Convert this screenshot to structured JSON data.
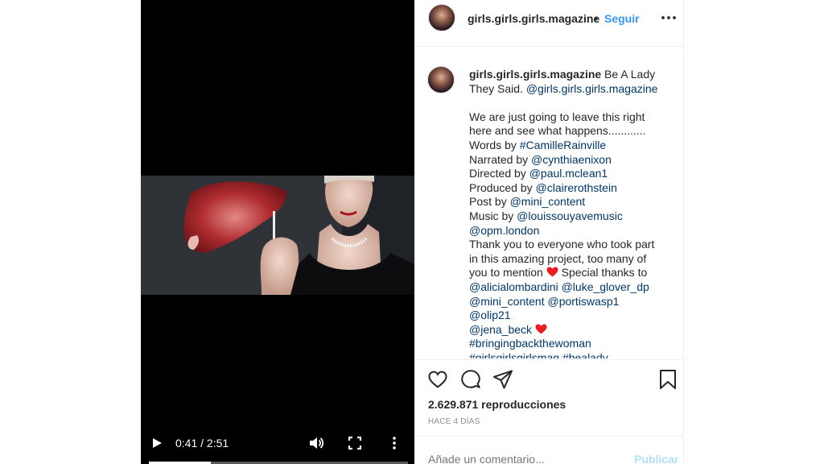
{
  "video": {
    "current_time": "0:41",
    "separator": "/",
    "duration": "2:51",
    "progress_fraction": 0.24
  },
  "header": {
    "username": "girls.girls.girls.magazine",
    "dot": "•",
    "follow_label": "Seguir"
  },
  "caption": {
    "username": "girls.girls.girls.magazine",
    "line1_text": " Be A Lady They Said. ",
    "line1_mention": "@girls.girls.girls.magazine",
    "line2": "We are just going to leave this right here and see what happens............",
    "words_prefix": "Words by ",
    "words_tag": "#CamilleRainville",
    "narrated_prefix": "Narrated by ",
    "narrated_mention": "@cynthiaenixon",
    "directed_prefix": "Directed by ",
    "directed_mention": "@paul.mclean1",
    "produced_prefix": "Produced by ",
    "produced_mention": "@clairerothstein",
    "post_prefix": "Post by ",
    "post_mention": "@mini_content",
    "music_prefix": "Music by ",
    "music_mention": "@louissouyavemusic",
    "opm_mention": "@opm.london",
    "thanks_text": "Thank you to everyone who took part in this amazing project, too many of you to mention ",
    "special_text": " Special thanks to ",
    "mentions": [
      "@alicialombardini",
      "@luke_glover_dp",
      "@mini_content",
      "@portiswasp1",
      "@olip21",
      "@jena_beck"
    ],
    "hashtags": [
      "#bringingbackthewoman",
      "#girlsgirlsgirlsmag",
      "#bealady"
    ]
  },
  "stats": {
    "views": "2.629.871 reproducciones",
    "time_ago": "HACE 4 DÍAS"
  },
  "comment": {
    "placeholder": "Añade un comentario...",
    "publish_label": "Publicar"
  },
  "icons": {
    "play": "play-icon",
    "volume": "volume-icon",
    "fullscreen": "fullscreen-icon",
    "more": "more-vertical-icon",
    "options": "more-horizontal-icon",
    "like": "heart-outline-icon",
    "comment": "comment-icon",
    "share": "send-icon",
    "save": "bookmark-icon",
    "emoji": "red-heart-icon"
  },
  "colors": {
    "link": "#00376b",
    "follow": "#3897f0",
    "heart": "#ed1c24"
  }
}
